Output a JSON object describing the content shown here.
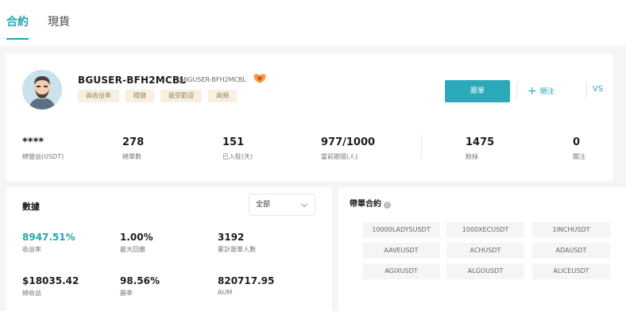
{
  "tabs": [
    {
      "label": "合約",
      "active": true
    },
    {
      "label": "現貨",
      "active": false
    }
  ],
  "profile": {
    "username": "BGUSER-BFH2MCBL",
    "handle": "@BGUSER-BFH2MCBL",
    "tags": [
      "高收益率",
      "穩健",
      "最受歡迎",
      "高頻"
    ],
    "copy_button": "跟單",
    "follow_button": "關注",
    "vs_label": "VS",
    "accent_color": "#2ba8ba"
  },
  "stats": [
    {
      "value": "****",
      "label": "總營益(USDT)"
    },
    {
      "value": "278",
      "label": "總單數"
    },
    {
      "value": "151",
      "label": "已入駐(天)"
    },
    {
      "value": "977/1000",
      "label": "當前跟隨(人)"
    },
    {
      "value": "1475",
      "label": "粉絲"
    },
    {
      "value": "0",
      "label": "關注"
    }
  ],
  "data_section": {
    "title": "數據",
    "filter": "全部",
    "metrics": [
      {
        "value": "8947.51%",
        "label": "收益率"
      },
      {
        "value": "1.00%",
        "label": "最大回撤"
      },
      {
        "value": "3192",
        "label": "累計跟單人數"
      },
      {
        "value": "$18035.42",
        "label": "總收益"
      },
      {
        "value": "98.56%",
        "label": "勝率"
      },
      {
        "value": "820717.95",
        "label": "AUM"
      }
    ]
  },
  "contracts": {
    "title": "帶單合約",
    "info_icon": "i",
    "items": [
      "10000LADYSUSDT",
      "1000XECUSDT",
      "1INCHUSDT",
      "AAVEUSDT",
      "ACHUSDT",
      "ADAUSDT",
      "AGIXUSDT",
      "ALGOUSDT",
      "ALICEUSDT"
    ]
  }
}
